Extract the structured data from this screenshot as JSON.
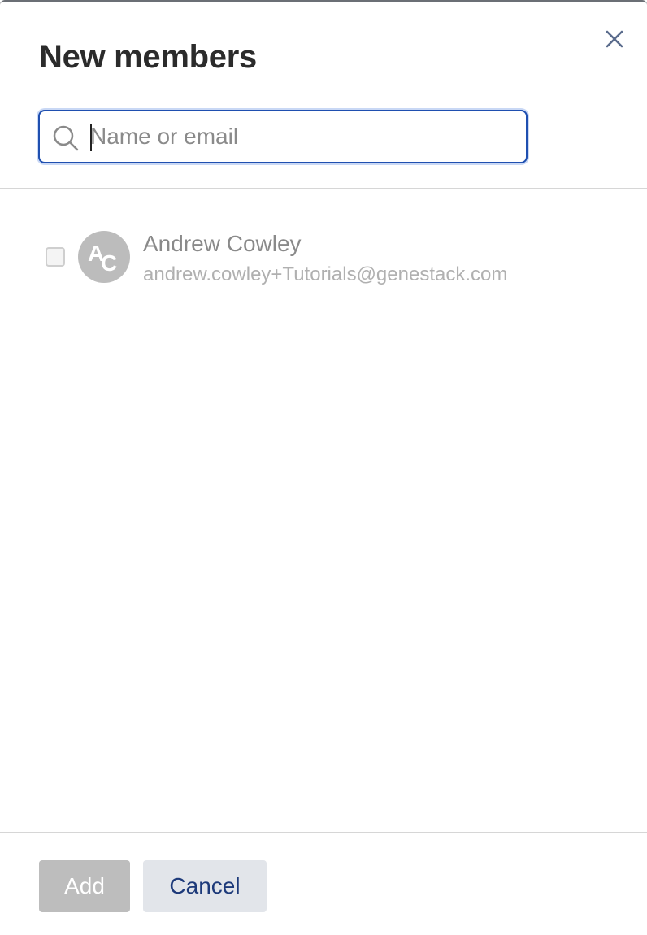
{
  "dialog": {
    "title": "New members",
    "close_icon": "close-icon",
    "search": {
      "placeholder": "Name or email",
      "value": "",
      "icon": "search-icon"
    },
    "members": [
      {
        "name": "Andrew Cowley",
        "email": "andrew.cowley+Tutorials@genestack.com",
        "initials": [
          "A",
          "C"
        ],
        "checked": false
      }
    ],
    "buttons": {
      "add_label": "Add",
      "cancel_label": "Cancel"
    },
    "colors": {
      "accent": "#1f4fb0",
      "avatar_bg": "#bcbcbc",
      "add_disabled_bg": "#bdbdbd",
      "cancel_bg": "#e2e5ea",
      "cancel_text": "#1d3a7a"
    }
  }
}
